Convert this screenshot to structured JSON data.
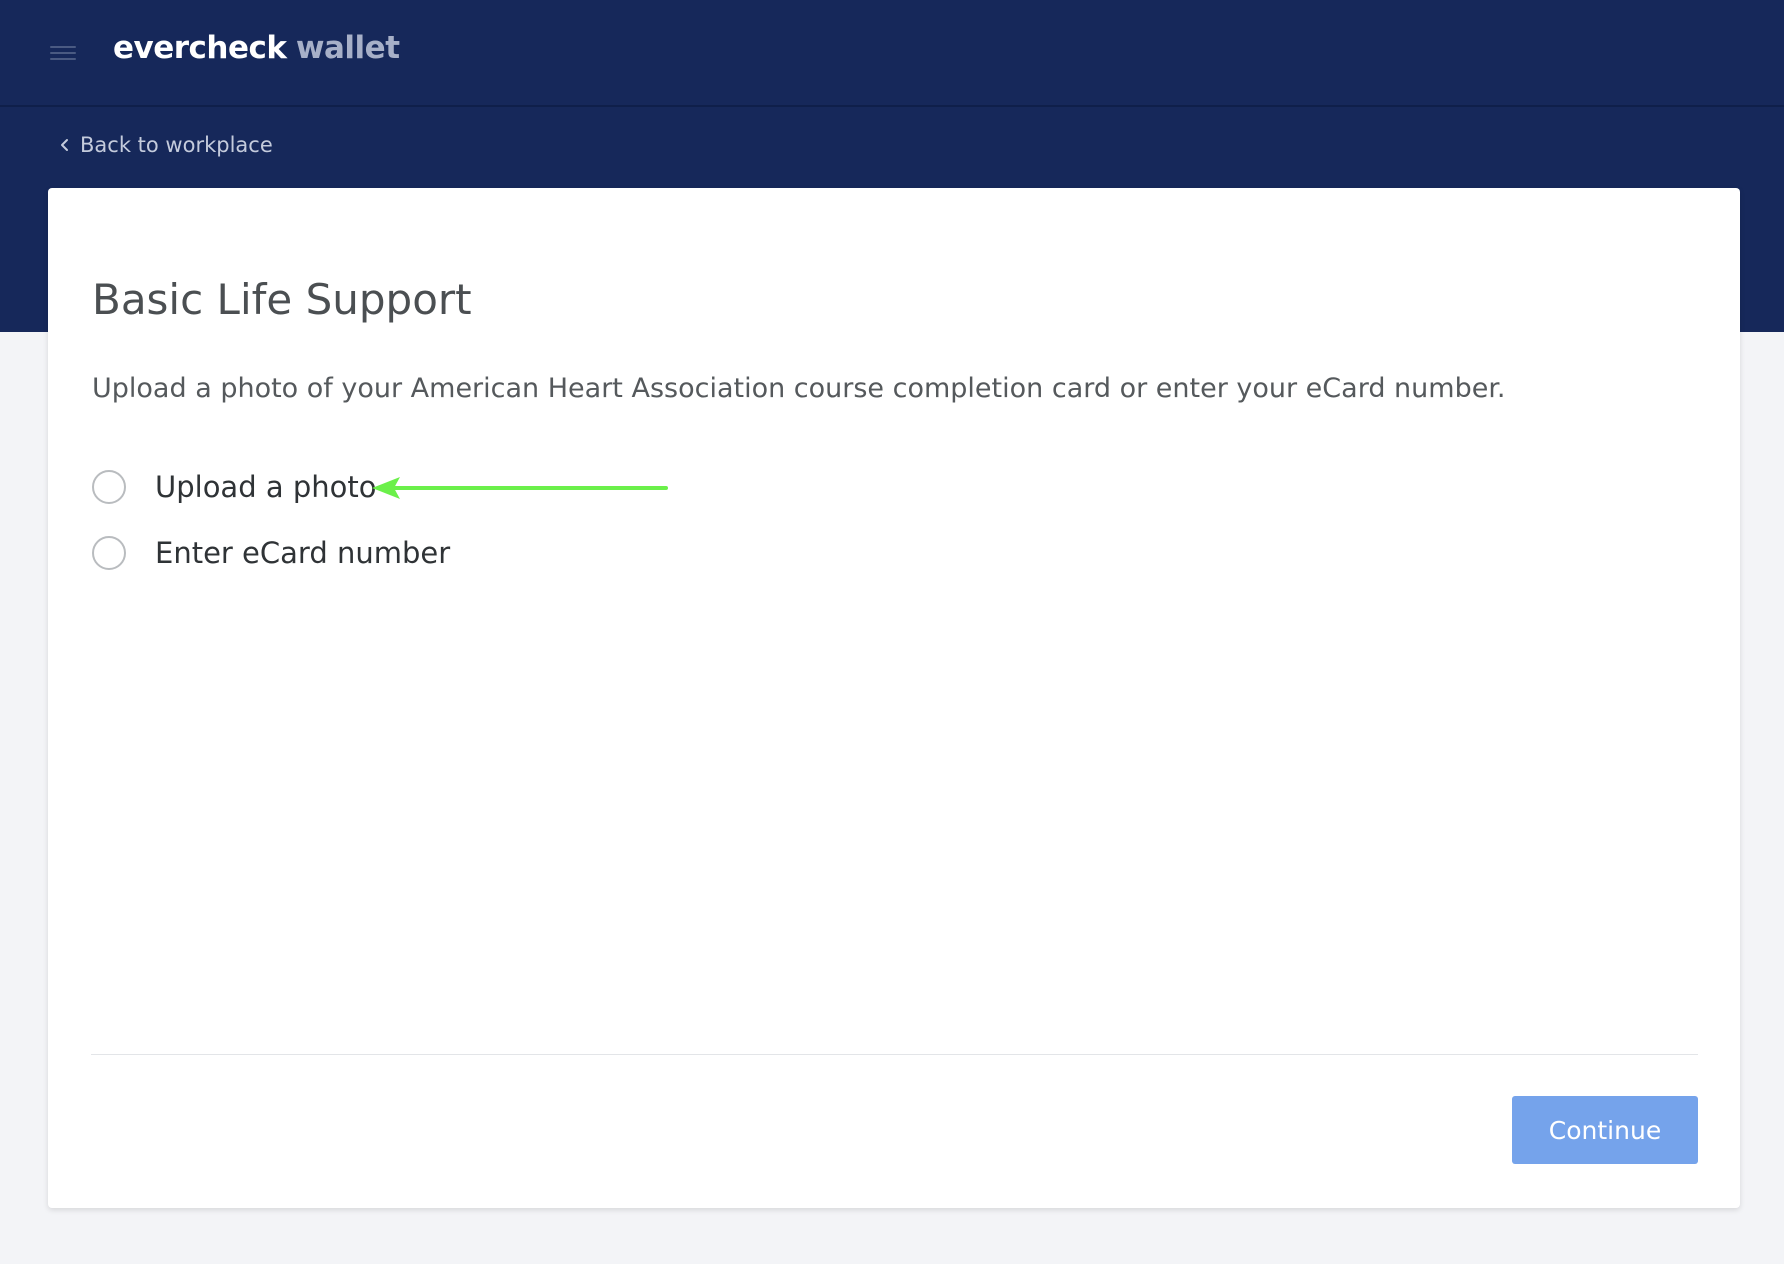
{
  "header": {
    "brand_main": "evercheck",
    "brand_sub": "wallet",
    "menu_icon": "hamburger-menu-icon"
  },
  "nav": {
    "back_label": "Back to workplace",
    "back_icon": "chevron-left-icon"
  },
  "page": {
    "title": "Basic Life Support",
    "description": "Upload a photo of your American Heart Association course completion card or enter your eCard number."
  },
  "options": [
    {
      "label": "Upload a photo",
      "selected": false
    },
    {
      "label": "Enter eCard number",
      "selected": false
    }
  ],
  "annotation": {
    "arrow_icon": "arrow-left-icon",
    "color": "#6bf04a"
  },
  "footer": {
    "continue_label": "Continue"
  },
  "colors": {
    "header_bg": "#16285a",
    "page_bg": "#f3f4f7",
    "button_bg": "#75a3eb"
  }
}
